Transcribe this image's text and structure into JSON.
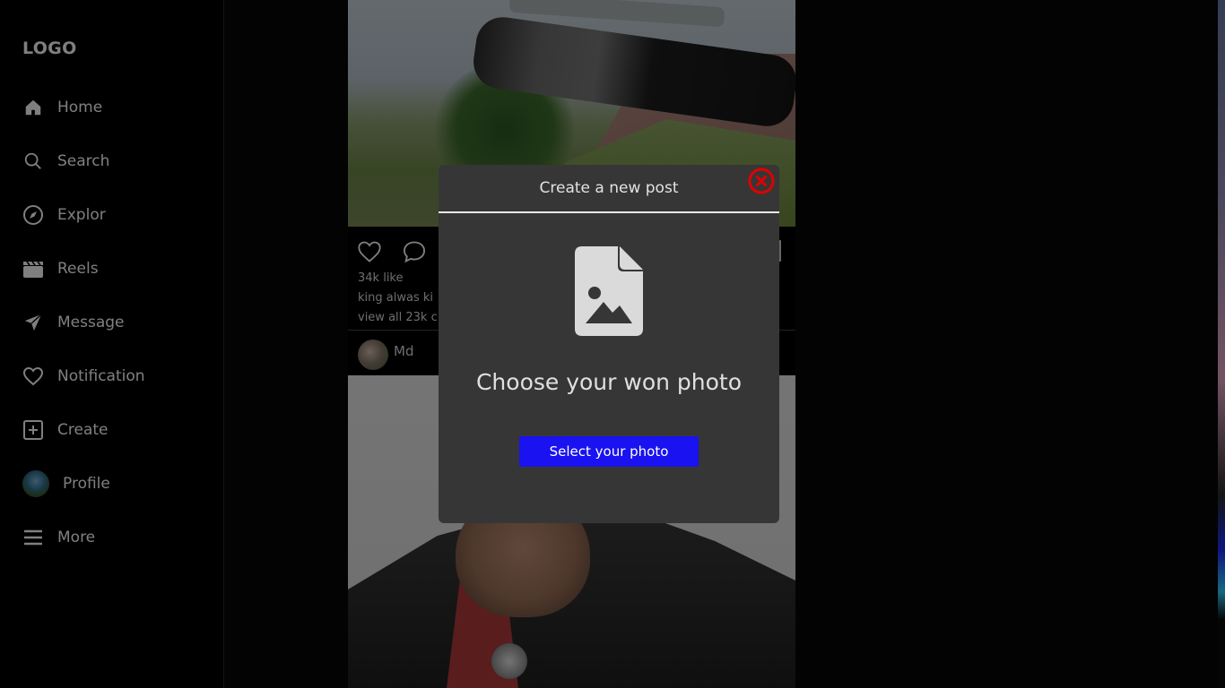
{
  "sidebar": {
    "logo": "LOGO",
    "items": [
      {
        "label": "Home",
        "icon": "home-icon"
      },
      {
        "label": "Search",
        "icon": "search-icon"
      },
      {
        "label": "Explor",
        "icon": "compass-icon"
      },
      {
        "label": "Reels",
        "icon": "clapperboard-icon"
      },
      {
        "label": "Message",
        "icon": "send-icon"
      },
      {
        "label": "Notification",
        "icon": "heart-icon"
      },
      {
        "label": "Create",
        "icon": "plus-square-icon"
      },
      {
        "label": "Profile",
        "icon": "avatar"
      },
      {
        "label": "More",
        "icon": "menu-icon"
      }
    ]
  },
  "feed": {
    "post1": {
      "likes": "34k like",
      "caption": "king alwas ki",
      "comments": "view all 23k c"
    },
    "post2": {
      "username": "Md"
    }
  },
  "modal": {
    "title": "Create a new post",
    "prompt": "Choose your won photo",
    "button_label": "Select your photo",
    "accent_color": "#1a12f0",
    "close_color": "#e00000"
  }
}
